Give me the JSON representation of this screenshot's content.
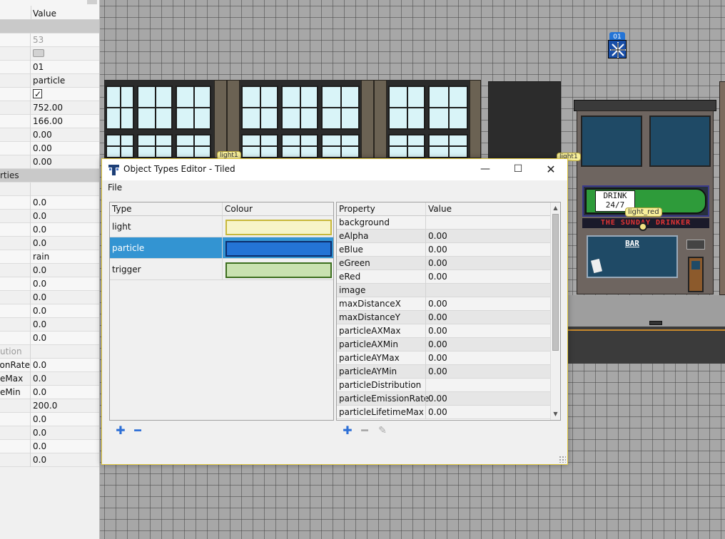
{
  "left_panel": {
    "header_value": "Value",
    "rows": [
      {
        "key": "",
        "value": "",
        "kind": "group"
      },
      {
        "key": "",
        "value": "53",
        "kind": "grey"
      },
      {
        "key": "",
        "value": "",
        "kind": "swatch"
      },
      {
        "key": "",
        "value": "01"
      },
      {
        "key": "",
        "value": "particle"
      },
      {
        "key": "",
        "value": "",
        "kind": "check"
      },
      {
        "key": "",
        "value": "752.00"
      },
      {
        "key": "",
        "value": "166.00"
      },
      {
        "key": "",
        "value": "0.00"
      },
      {
        "key": "",
        "value": "0.00"
      },
      {
        "key": "",
        "value": "0.00"
      },
      {
        "key": "rties",
        "value": "",
        "kind": "group"
      },
      {
        "key": "",
        "value": ""
      },
      {
        "key": "",
        "value": "0.0"
      },
      {
        "key": "",
        "value": "0.0"
      },
      {
        "key": "",
        "value": "0.0"
      },
      {
        "key": "",
        "value": "0.0"
      },
      {
        "key": "",
        "value": "rain"
      },
      {
        "key": "",
        "value": "0.0"
      },
      {
        "key": "",
        "value": "0.0"
      },
      {
        "key": "",
        "value": "0.0"
      },
      {
        "key": "",
        "value": "0.0"
      },
      {
        "key": "",
        "value": "0.0"
      },
      {
        "key": "",
        "value": "0.0"
      },
      {
        "key": "ution",
        "value": "",
        "kind": "grey"
      },
      {
        "key": "onRate",
        "value": "0.0"
      },
      {
        "key": "eMax",
        "value": "0.0"
      },
      {
        "key": "eMin",
        "value": "0.0"
      },
      {
        "key": "",
        "value": "200.0"
      },
      {
        "key": "",
        "value": "0.0"
      },
      {
        "key": "",
        "value": "0.0"
      },
      {
        "key": "",
        "value": "0.0"
      },
      {
        "key": "",
        "value": "0.0"
      }
    ]
  },
  "canvas": {
    "labels": {
      "light_a": "light1",
      "light_b": "light1",
      "light_red": "light_red",
      "selected_obj": "01",
      "sign_drink": "DRINK",
      "sign_247": "24/7",
      "sign_bar_name": "THE SUNDAY DRINKER",
      "sign_bar": "BAR"
    }
  },
  "dialog": {
    "title": "Object Types Editor - Tiled",
    "menu": [
      "File"
    ],
    "types_table": {
      "headers": [
        "Type",
        "Colour"
      ],
      "rows": [
        {
          "name": "light",
          "fill": "#f7f4c8",
          "border": "#c8b83a"
        },
        {
          "name": "particle",
          "fill": "#2474d6",
          "border": "#0c2e6e",
          "selected": true
        },
        {
          "name": "trigger",
          "fill": "#c9e2b0",
          "border": "#3c6e1e"
        }
      ]
    },
    "props_table": {
      "headers": [
        "Property",
        "Value"
      ],
      "rows": [
        {
          "key": "background",
          "value": ""
        },
        {
          "key": "eAlpha",
          "value": "0.00"
        },
        {
          "key": "eBlue",
          "value": "0.00"
        },
        {
          "key": "eGreen",
          "value": "0.00"
        },
        {
          "key": "eRed",
          "value": "0.00"
        },
        {
          "key": "image",
          "value": ""
        },
        {
          "key": "maxDistanceX",
          "value": "0.00"
        },
        {
          "key": "maxDistanceY",
          "value": "0.00"
        },
        {
          "key": "particleAXMax",
          "value": "0.00"
        },
        {
          "key": "particleAXMin",
          "value": "0.00"
        },
        {
          "key": "particleAYMax",
          "value": "0.00"
        },
        {
          "key": "particleAYMin",
          "value": "0.00"
        },
        {
          "key": "particleDistribution",
          "value": ""
        },
        {
          "key": "particleEmissionRate",
          "value": "0.00"
        },
        {
          "key": "particleLifetimeMax",
          "value": "0.00"
        }
      ]
    },
    "buttons": {
      "add_icon": "plus-icon",
      "remove_icon": "minus-icon",
      "edit_icon": "pencil-icon"
    }
  }
}
